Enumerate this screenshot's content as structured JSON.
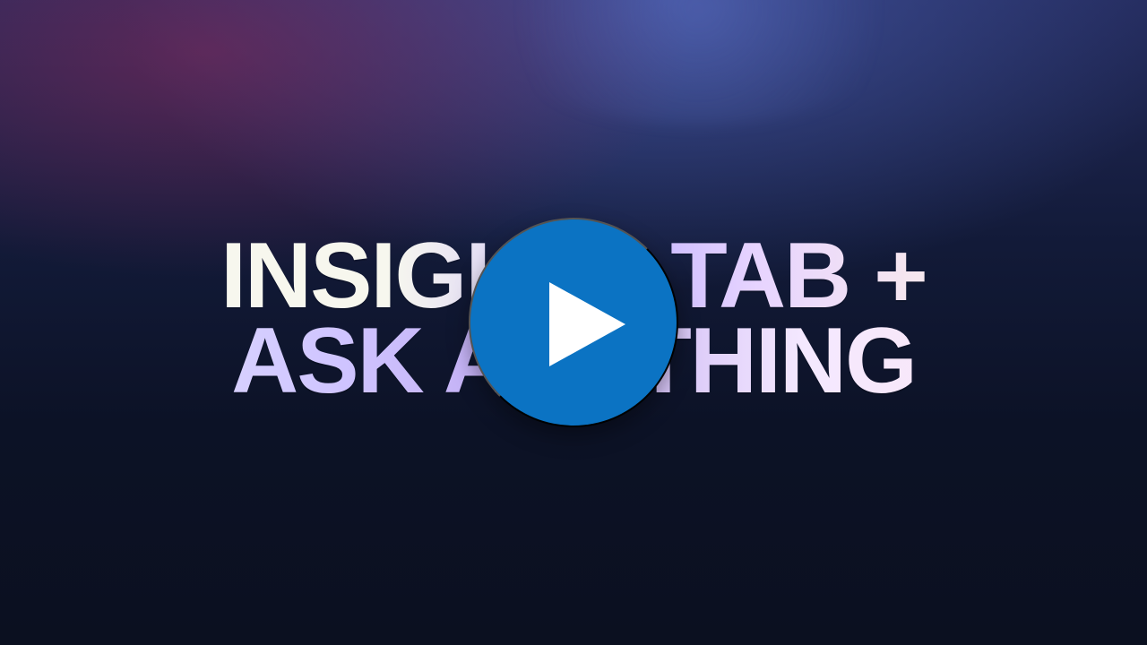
{
  "video": {
    "title_line_1": "INSIGHTS TAB +",
    "title_line_2": "ASK ANYTHING",
    "play_button_label": "Play"
  },
  "colors": {
    "play_button": "#0b73c3",
    "background_top": "#232a5b",
    "background_bottom": "#0b1020"
  },
  "icons": {
    "play": "play-icon"
  }
}
